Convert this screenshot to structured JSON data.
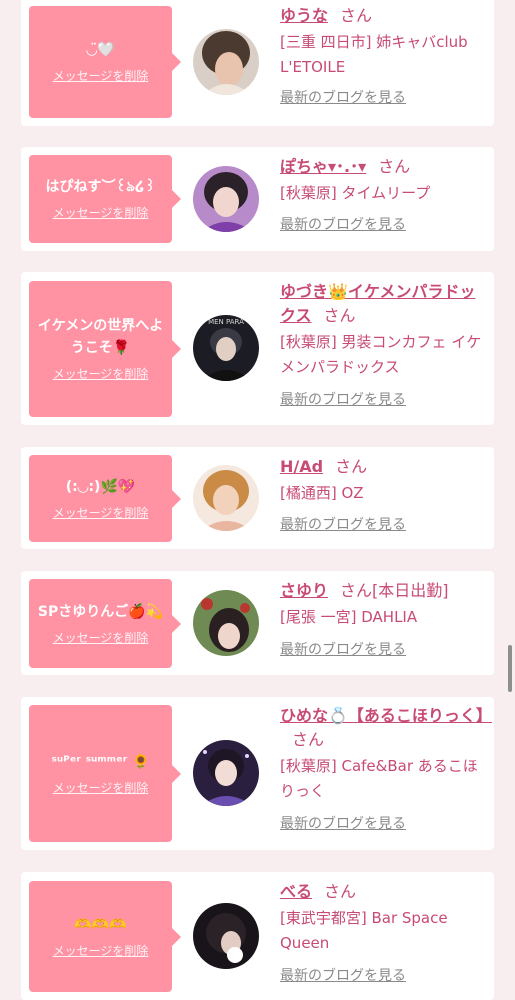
{
  "delete_label": "メッセージを削除",
  "blog_label": "最新のブログを見る",
  "honorific": "さん",
  "colors": {
    "page_bg": "#f8eef0",
    "bubble": "#ff93a4",
    "name": "#c84b74",
    "link_gray": "#8a8a8a"
  },
  "cards": [
    {
      "message": "◡̈🤍",
      "name": "ゆうな",
      "name_extra": "",
      "shop": "[三重 四日市] 姉キャバclub L'ETOILE",
      "avatar_icon": "avatar-photo"
    },
    {
      "message": "はぴねす︶꒰ঌ໒꒱",
      "name": "ぽちゃ▾･.･▾",
      "name_extra": "",
      "shop": "[秋葉原] タイムリープ",
      "avatar_icon": "avatar-photo"
    },
    {
      "message": "イケメンの世界へようこそ🌹",
      "name": "ゆづき👑イケメンパラドックス",
      "name_extra": "",
      "shop": "[秋葉原] 男装コンカフェ イケメンパラドックス",
      "avatar_icon": "avatar-photo"
    },
    {
      "message": "(:◡:)🌿💖",
      "name": "H/Ad",
      "name_extra": "",
      "shop": "[橘通西] OZ",
      "avatar_icon": "avatar-photo"
    },
    {
      "message": "SPさゆりんご🍎💫",
      "name": "さゆり",
      "name_extra": "[本日出勤]",
      "shop": "[尾張 一宮] DAHLIA",
      "avatar_icon": "avatar-photo"
    },
    {
      "message": "ˢᵘᴾᵉʳ ˢᵘᵐᵐᵉʳ 🌻",
      "name": "ひめな💍【あるこほりっく】",
      "name_extra": "",
      "shop": "[秋葉原] Cafe&Bar あるこほりっく",
      "avatar_icon": "avatar-photo"
    },
    {
      "message": "🫶🫶🫶",
      "name": "べる",
      "name_extra": "",
      "shop": "[東武宇都宮] Bar Space Queen",
      "avatar_icon": "avatar-photo"
    }
  ]
}
